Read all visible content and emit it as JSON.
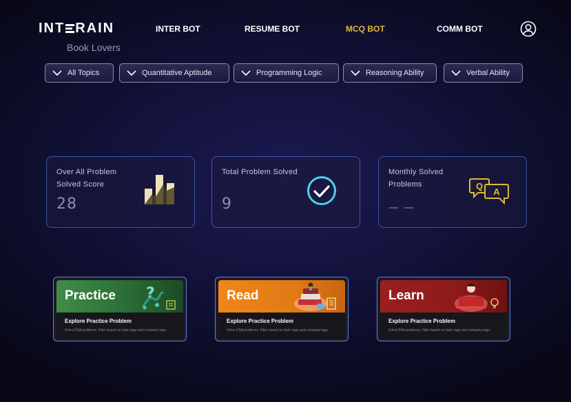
{
  "brand": {
    "logo": "INTERAIN",
    "logo_left": "INT",
    "logo_right": "RAIN",
    "tagline": "Book Lovers"
  },
  "nav": [
    {
      "label": "INTER BOT",
      "active": false
    },
    {
      "label": "RESUME BOT",
      "active": false
    },
    {
      "label": "MCQ BOT",
      "active": true
    },
    {
      "label": "COMM BOT",
      "active": false
    }
  ],
  "filters": [
    {
      "label": "All Topics"
    },
    {
      "label": "Quantitative Aptitude"
    },
    {
      "label": "Programming Logic"
    },
    {
      "label": "Reasoning Ability"
    },
    {
      "label": "Verbal Ability"
    }
  ],
  "stats": [
    {
      "label": "Over All Problem Solved Score",
      "value": "28",
      "icon": "bar-chart-icon"
    },
    {
      "label": "Total Problem Solved",
      "value": "9",
      "icon": "check-circle-icon"
    },
    {
      "label": "Monthly Solved Problems",
      "value": "— —",
      "icon": "qa-chat-icon"
    }
  ],
  "cards": [
    {
      "title": "Practice",
      "subtitle": "Explore Practice Problem",
      "description": "Solve DSA problems. Filter based on topic tags and company tags.",
      "color": "#2f7a3e"
    },
    {
      "title": "Read",
      "subtitle": "Explore Practice Problem",
      "description": "Solve DSA problems. Filter based on topic tags and company tags.",
      "color": "#e07a15"
    },
    {
      "title": "Learn",
      "subtitle": "Explore Practice Problem",
      "description": "Solve DSA problems. Filter based on topic tags and company tags.",
      "color": "#8e1a1a"
    }
  ],
  "colors": {
    "accent": "#e2b93b",
    "stat_border": "#3f52a8",
    "card_border": "#6a7fd8",
    "check": "#4fd1e8"
  }
}
